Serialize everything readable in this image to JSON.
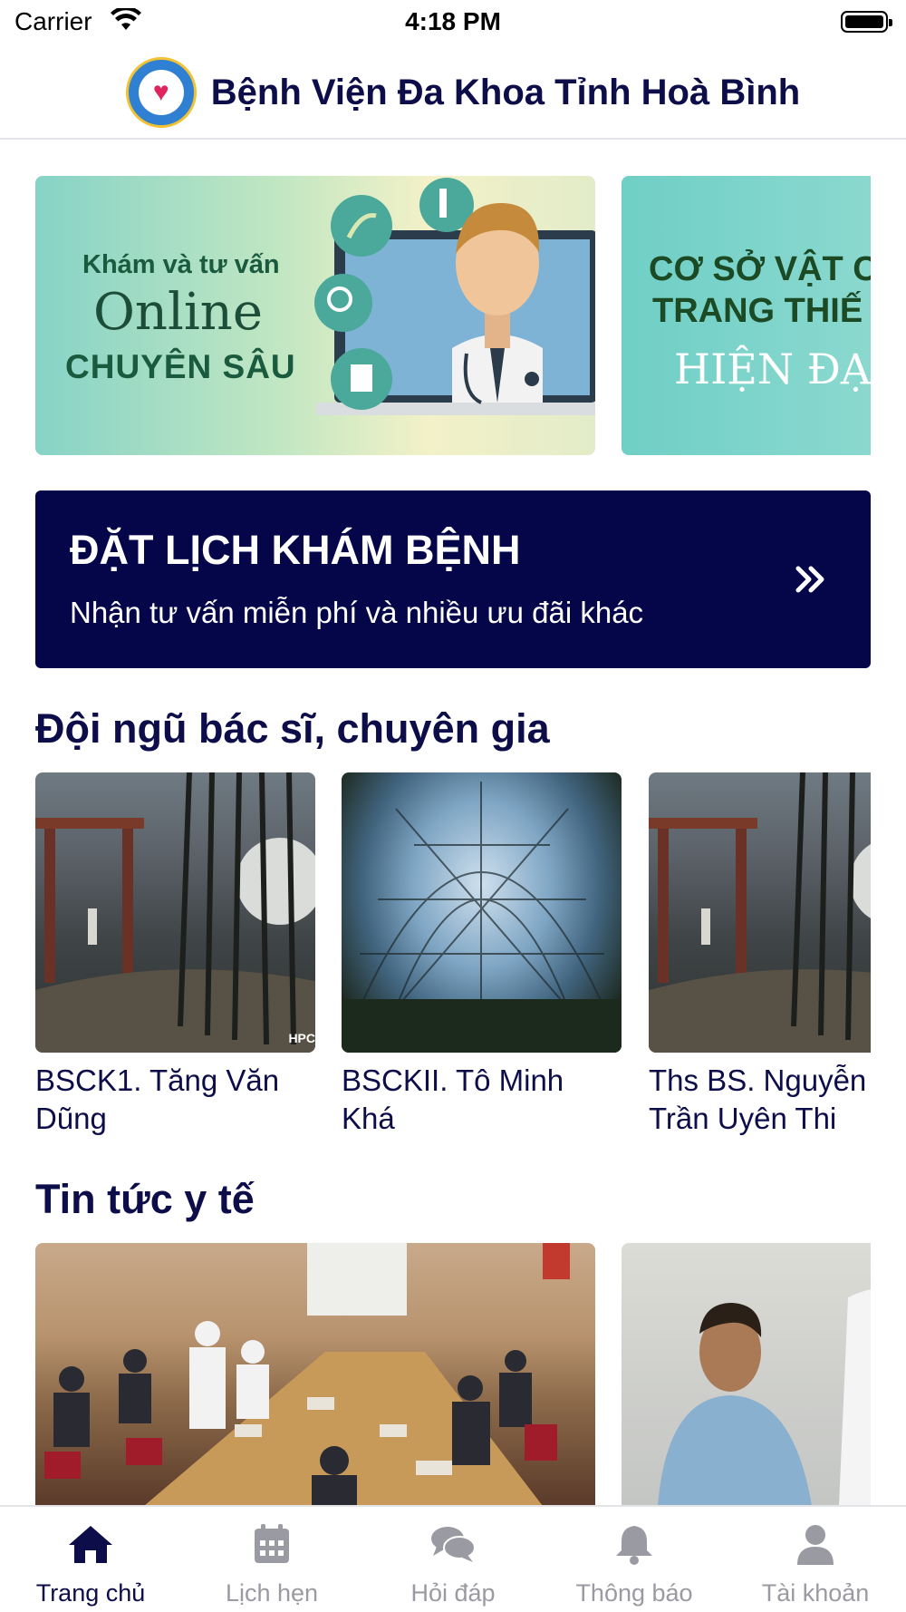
{
  "status_bar": {
    "carrier": "Carrier",
    "time": "4:18 PM"
  },
  "header": {
    "title": "Bệnh Viện Đa Khoa Tỉnh Hoà Bình"
  },
  "banners": [
    {
      "line1": "Khám và tư vấn",
      "line2": "Online",
      "line3": "CHUYÊN SÂU"
    },
    {
      "line1": "CƠ SỞ VẬT C",
      "line2": "TRANG THIẾ",
      "line3": "HIỆN ĐẠ"
    }
  ],
  "booking": {
    "title": "ĐẶT LỊCH KHÁM BỆNH",
    "subtitle": "Nhận tư vấn miễn phí và nhiều ưu đãi khác"
  },
  "doctors_section": {
    "title": "Đội ngũ bác sĩ, chuyên gia",
    "doctors": [
      {
        "name_line1": "BSCK1. Tăng Văn",
        "name_line2": "Dũng",
        "watermark": "HPC"
      },
      {
        "name_line1": "BSCKII. Tô Minh",
        "name_line2": "Khá"
      },
      {
        "name_line1": "Ths BS. Nguyễn",
        "name_line2": "Trần Uyên Thi"
      }
    ]
  },
  "news_section": {
    "title": "Tin tức y tế"
  },
  "tab_bar": {
    "active_color": "#0d0d4a",
    "inactive_color": "#9a9aa3",
    "tabs": [
      {
        "label": "Trang chủ",
        "icon": "home-icon",
        "active": true
      },
      {
        "label": "Lịch hẹn",
        "icon": "calendar-icon",
        "active": false
      },
      {
        "label": "Hỏi đáp",
        "icon": "chat-icon",
        "active": false
      },
      {
        "label": "Thông báo",
        "icon": "bell-icon",
        "active": false
      },
      {
        "label": "Tài khoản",
        "icon": "user-icon",
        "active": false
      }
    ]
  },
  "colors": {
    "primary": "#05054a",
    "text": "#0d0d4a"
  }
}
